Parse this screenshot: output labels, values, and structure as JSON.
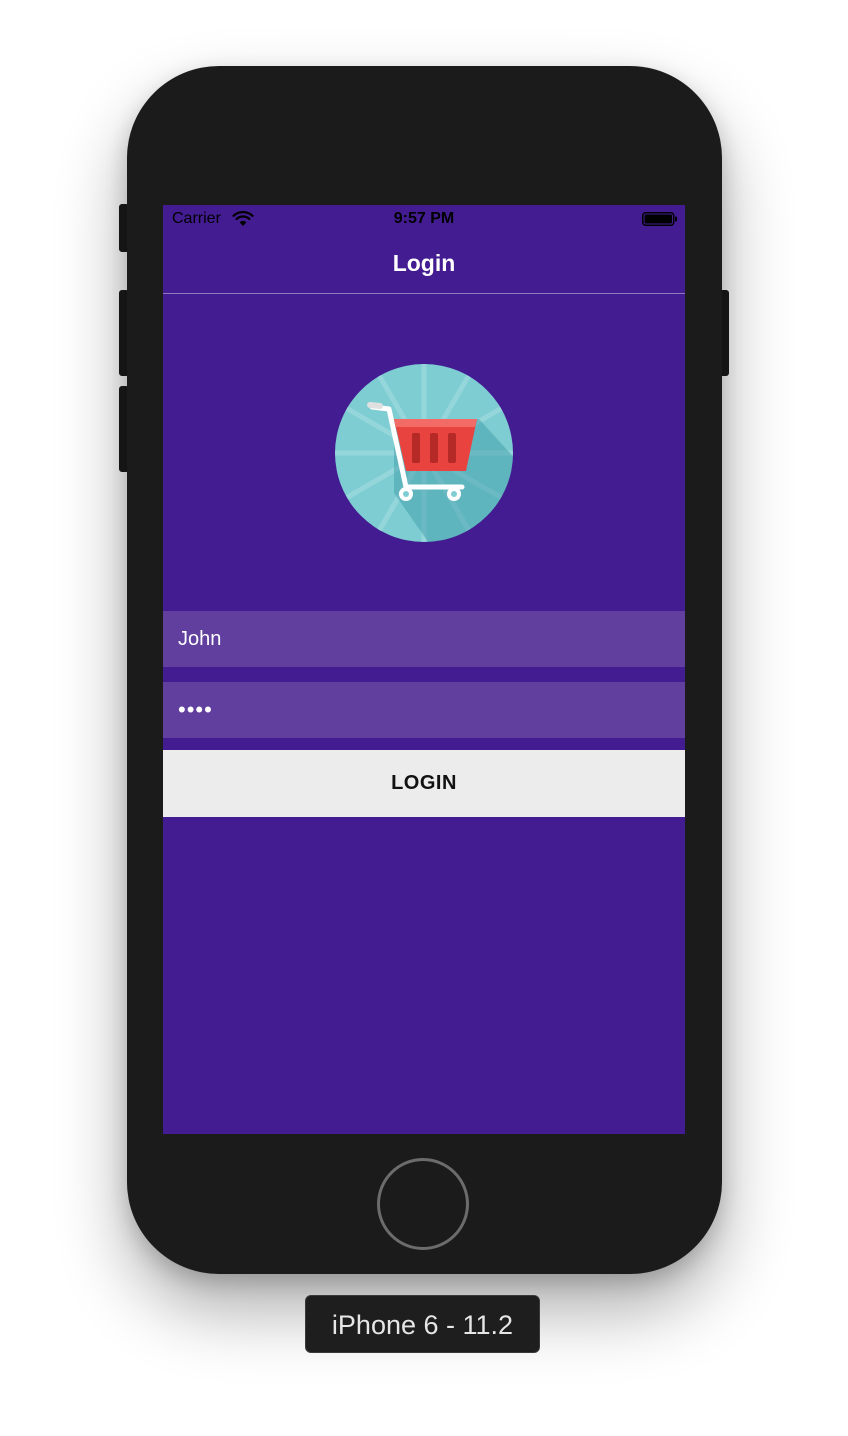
{
  "status_bar": {
    "carrier": "Carrier",
    "time": "9:57 PM",
    "wifi_icon": "wifi-icon",
    "battery_icon": "battery-full-icon"
  },
  "nav": {
    "title": "Login"
  },
  "logo": {
    "icon": "shopping-cart-icon"
  },
  "form": {
    "username_value": "John",
    "password_value": "••••",
    "login_label": "LOGIN"
  },
  "device": {
    "label": "iPhone 6 - 11.2"
  },
  "colors": {
    "background": "#431c91",
    "field": "#613f9f",
    "button": "#ececec",
    "logo_circle": "#7ecdd2",
    "cart_basket": "#e8433f"
  }
}
